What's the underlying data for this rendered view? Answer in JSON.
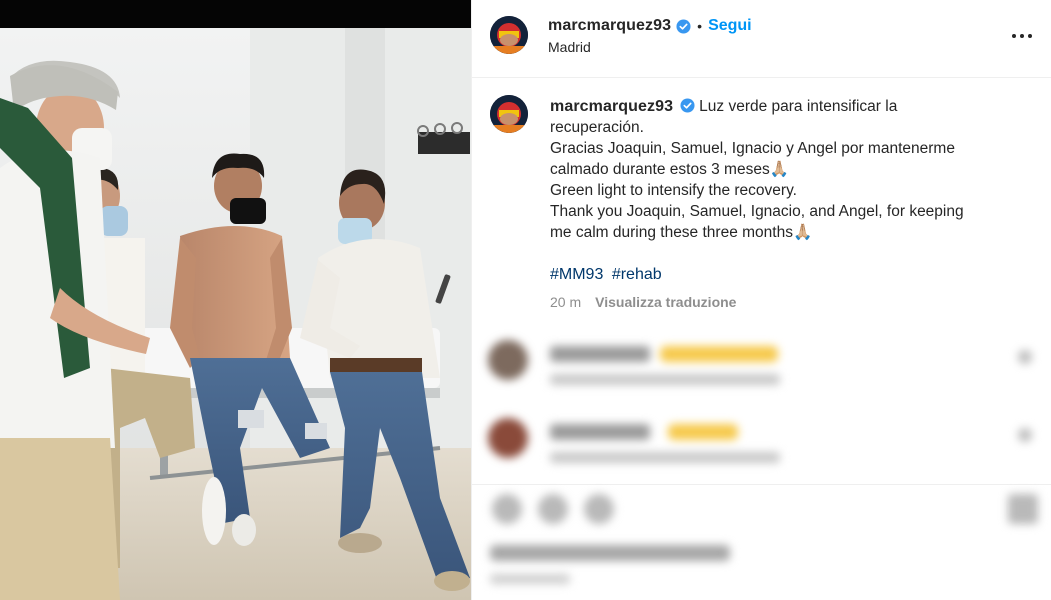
{
  "post": {
    "username": "marcmarquez93",
    "verified": true,
    "follow_label": "Segui",
    "separator": "•",
    "location": "Madrid",
    "more_icon": "more-horizontal-icon",
    "caption_lines": [
      "Luz verde para intensificar la",
      "recuperación.",
      "Gracias Joaquin, Samuel, Ignacio y Angel por mantenerme",
      "calmado durante estos 3 meses🙏🏼",
      "Green light to intensify the recovery.",
      "Thank you Joaquin, Samuel, Ignacio, and Angel, for keeping",
      "me calm during these three months🙏🏼"
    ],
    "hashtags": [
      "#MM93",
      "#rehab"
    ],
    "time_ago": "20 m",
    "translate_label": "Visualizza traduzione"
  },
  "colors": {
    "link_blue": "#0095f6",
    "hashtag_blue": "#00376b",
    "verified_blue": "#3897f0",
    "muted_text": "#8e8e8e"
  }
}
